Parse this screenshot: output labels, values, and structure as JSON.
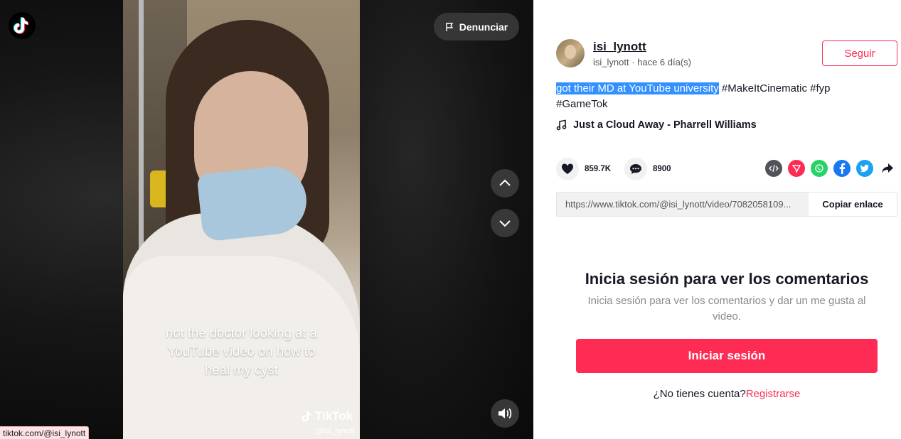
{
  "video": {
    "report_label": "Denunciar",
    "caption_lines": [
      "not the doctor looking at a",
      "YouTube video on how to",
      "heal my cyst"
    ],
    "watermark_brand": "TikTok",
    "watermark_user": "@isi_lynott"
  },
  "status_bar": {
    "url": "tiktok.com/@isi_lynott"
  },
  "author": {
    "username": "isi_lynott",
    "subline": "isi_lynott · hace 6 día(s)",
    "follow_label": "Seguir"
  },
  "description": {
    "highlighted": "got their MD at YouTube university",
    "hashtags_line1": " #MakeItCinematic #fyp",
    "hashtags_line2": "#GameTok"
  },
  "music": {
    "title": "Just a Cloud Away - Pharrell Williams"
  },
  "stats": {
    "likes": "859.7K",
    "comments": "8900"
  },
  "share_icons": [
    "embed-icon",
    "tiktok-send-icon",
    "whatsapp-icon",
    "facebook-icon",
    "twitter-icon",
    "share-arrow-icon"
  ],
  "link": {
    "url": "https://www.tiktok.com/@isi_lynott/video/7082058109...",
    "copy_label": "Copiar enlace"
  },
  "login": {
    "title": "Inicia sesión para ver los comentarios",
    "subtitle": "Inicia sesión para ver los comentarios y dar un me gusta al video.",
    "button_label": "Iniciar sesión",
    "signup_prompt": "¿No tienes cuenta?",
    "signup_link": "Registrarse"
  },
  "colors": {
    "accent": "#fe2c55",
    "highlight": "#3390ff",
    "text": "#161823"
  }
}
